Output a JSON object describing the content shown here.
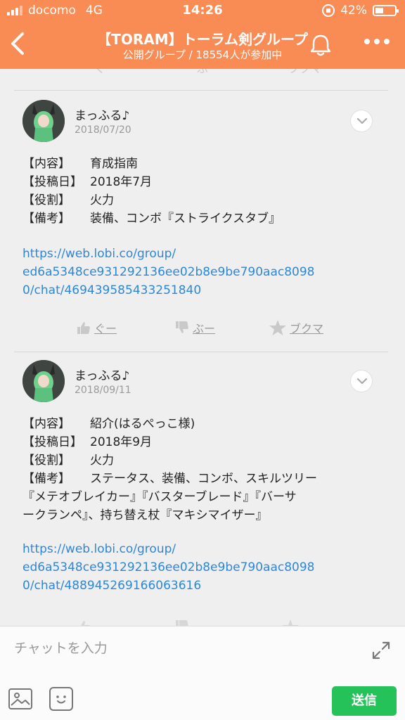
{
  "status_bar": {
    "carrier": "docomo",
    "network": "4G",
    "time": "14:26",
    "battery": "42%",
    "battery_level": 0.42
  },
  "header": {
    "title": "【TORAM】トーラム剣グループ",
    "subtitle": "公開グループ / 18554人が参加中",
    "back_icon": "chevron-left-icon",
    "bell_icon": "bell-icon",
    "more_icon": "more-horizontal-icon",
    "accent_color": "#f98b54"
  },
  "ghost_actions": [
    "ぐー",
    "ぶー",
    "ブクマ"
  ],
  "posts": [
    {
      "author": "まっふる♪",
      "date": "2018/07/20",
      "rows": [
        {
          "key": "【内容】",
          "value": "育成指南"
        },
        {
          "key": "【投稿日】",
          "value": "2018年7月"
        },
        {
          "key": "【役割】",
          "value": "火力"
        },
        {
          "key": "【備考】",
          "value": "装備、コンボ『ストライクスタブ』"
        }
      ],
      "link": "https://web.lobi.co/group/ed6a5348ce931292136ee02b8e9be790aac80980/chat/469439585433251840",
      "link_lines": [
        "https://web.lobi.co/group/",
        "ed6a5348ce931292136ee02b8e9be790aac8098",
        "0/chat/469439585433251840"
      ],
      "actions": {
        "like": "ぐー",
        "dislike": "ぶー",
        "bookmark": "ブクマ"
      }
    },
    {
      "author": "まっふる♪",
      "date": "2018/09/11",
      "rows": [
        {
          "key": "【内容】",
          "value": "紹介(はるぺっこ様)"
        },
        {
          "key": "【投稿日】",
          "value": "2018年9月"
        },
        {
          "key": "【役割】",
          "value": "火力"
        },
        {
          "key": "【備考】",
          "value": "ステータス、装備、コンボ、スキルツリー"
        }
      ],
      "extra_lines": [
        "『メテオブレイカー』『バスターブレード』『バーサ",
        "ークランペ』、持ち替え杖『マキシマイザー』"
      ],
      "link": "https://web.lobi.co/group/ed6a5348ce931292136ee02b8e9be790aac80980/chat/488945269166063616",
      "link_lines": [
        "https://web.lobi.co/group/",
        "ed6a5348ce931292136ee02b8e9be790aac8098",
        "0/chat/488945269166063616"
      ]
    }
  ],
  "composer": {
    "placeholder": "チャットを入力",
    "send_label": "送信",
    "send_color": "#25c25a"
  }
}
